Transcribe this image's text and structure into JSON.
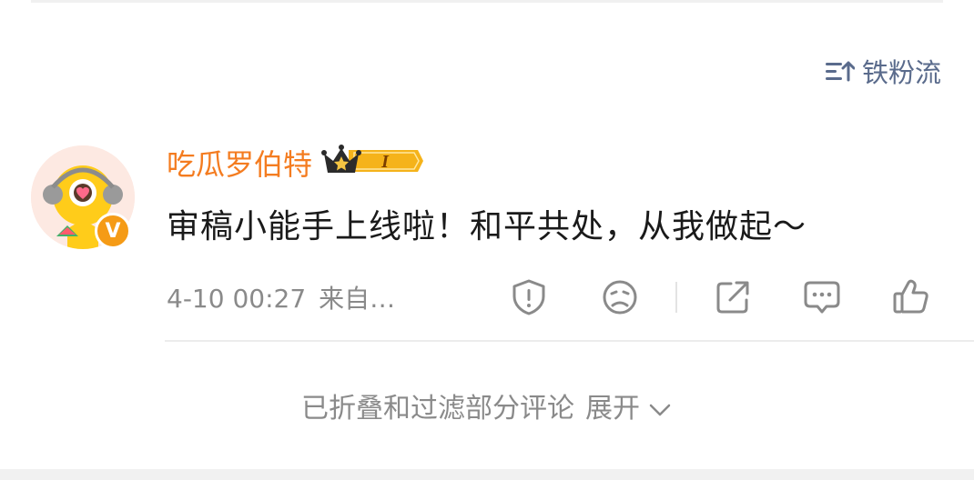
{
  "sort": {
    "icon": "sort-lines-up-icon",
    "label": "铁粉流"
  },
  "comment": {
    "avatar_icon": "yellow-mascot-avatar",
    "verified_badge": "V",
    "username": "吃瓜罗伯特",
    "rank_badge": {
      "icon": "crown-icon",
      "level": "I"
    },
    "text": "审稿小能手上线啦！和平共处，从我做起～",
    "timestamp": "4-10 00:27",
    "source": "来自…",
    "actions": [
      "report-shield-icon",
      "dislike-face-icon",
      "share-icon",
      "comment-bubble-icon",
      "like-thumb-icon"
    ]
  },
  "collapsed": {
    "text": "已折叠和过滤部分评论",
    "expand_label": "展开"
  },
  "colors": {
    "username": "#f47c20",
    "link_blue_gray": "#5a6b8c",
    "meta_gray": "#8a8a8a",
    "badge_gold": "#f5b31a"
  }
}
